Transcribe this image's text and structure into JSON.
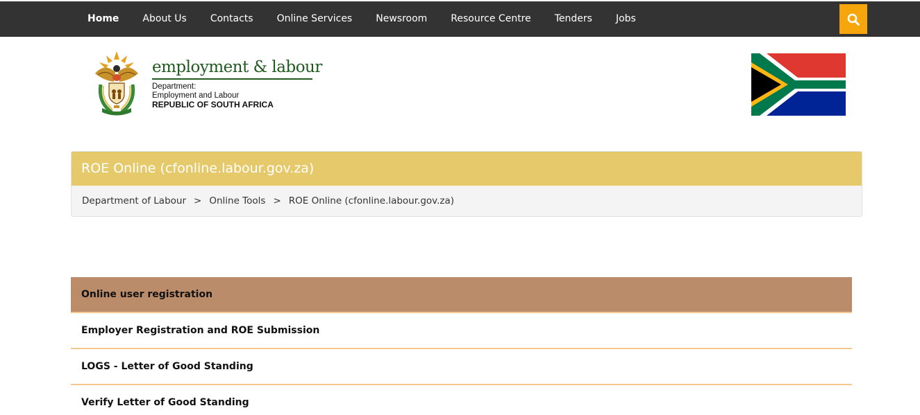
{
  "nav": {
    "items": [
      {
        "label": "Home",
        "active": true
      },
      {
        "label": "About Us"
      },
      {
        "label": "Contacts"
      },
      {
        "label": "Online Services"
      },
      {
        "label": "Newsroom"
      },
      {
        "label": "Resource Centre"
      },
      {
        "label": "Tenders"
      },
      {
        "label": "Jobs"
      }
    ],
    "search_icon": "search-icon",
    "search_color": "#f6a50b",
    "bar_color": "#333333"
  },
  "brand": {
    "name": "employment & labour",
    "line1": "Department:",
    "line2": "Employment and Labour",
    "line3": "REPUBLIC OF SOUTH AFRICA",
    "emblem_icon": "coat-of-arms",
    "flag_icon": "south-africa-flag"
  },
  "page": {
    "title": "ROE Online (cfonline.labour.gov.za)",
    "title_bg": "#e5c96b",
    "breadcrumb": [
      "Department of Labour",
      "Online Tools",
      "ROE Online (cfonline.labour.gov.za)"
    ],
    "breadcrumb_separator": ">"
  },
  "links": {
    "items": [
      {
        "label": "Online user registration",
        "highlight": true
      },
      {
        "label": "Employer Registration and ROE Submission"
      },
      {
        "label": "LOGS - Letter of Good Standing"
      },
      {
        "label": "Verify Letter of Good Standing"
      }
    ],
    "highlight_bg": "#bb8c6a",
    "divider_color": "#f5c88f"
  }
}
